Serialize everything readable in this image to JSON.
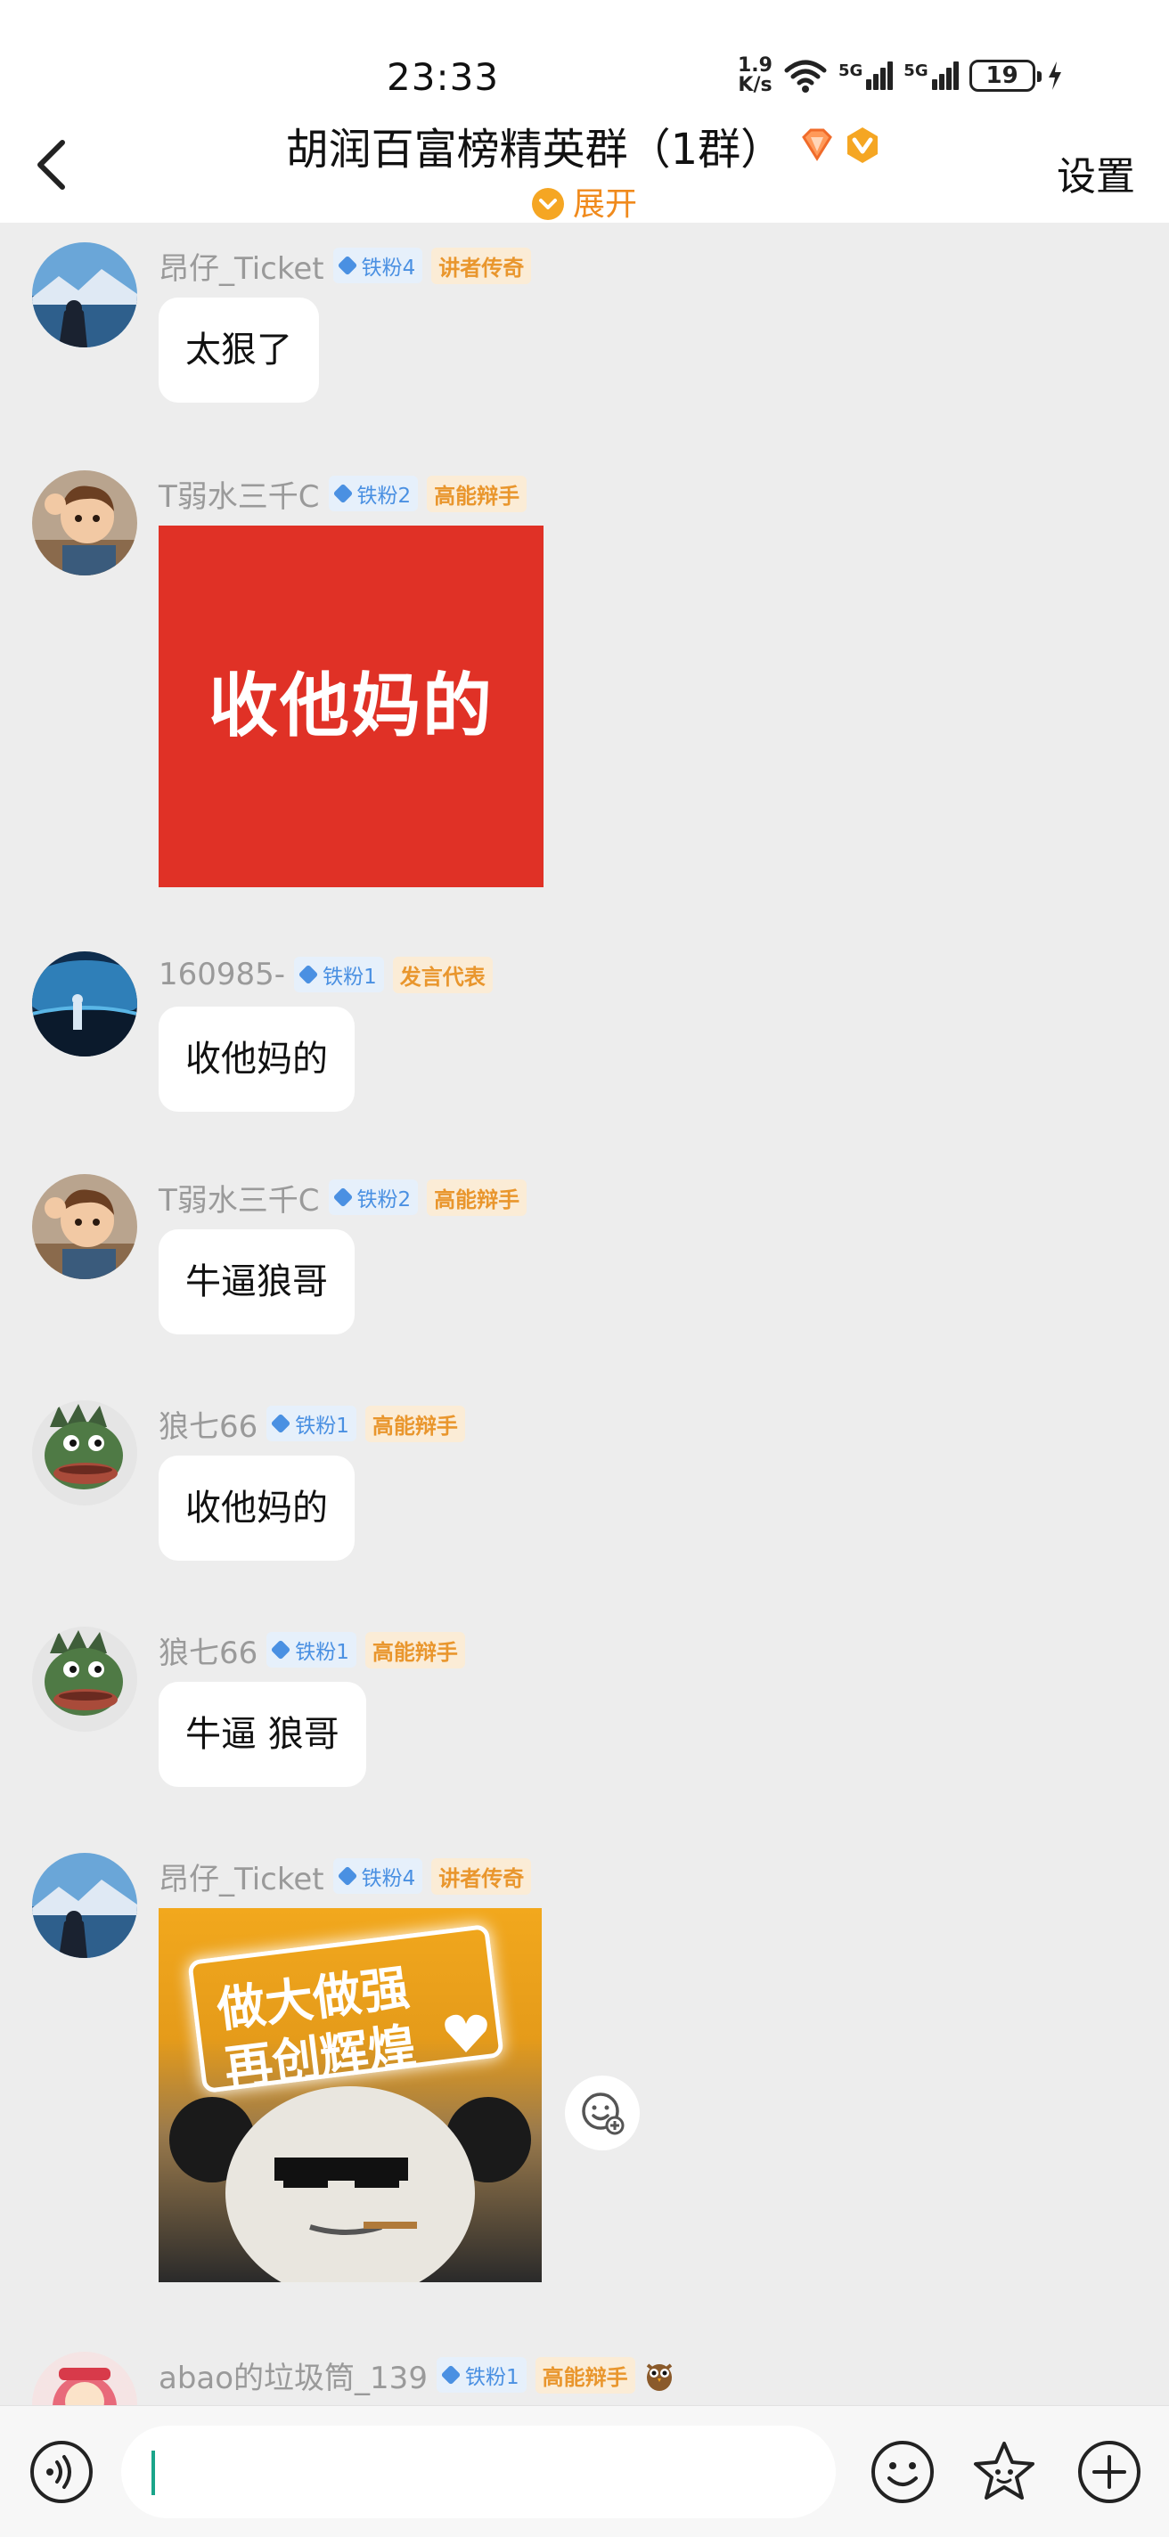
{
  "status_bar": {
    "time": "23:33",
    "net_speed_value": "1.9",
    "net_speed_unit": "K/s",
    "signal1_label": "5G",
    "signal2_label": "5G",
    "battery": "19"
  },
  "header": {
    "title": "胡润百富榜精英群（1群）",
    "expand_label": "展开",
    "settings_label": "设置"
  },
  "messages": [
    {
      "user": "昂仔_Ticket",
      "fan": "铁粉4",
      "tag": "讲者传奇",
      "text": "太狠了"
    },
    {
      "user": "T弱水三千C",
      "fan": "铁粉2",
      "tag": "高能辩手",
      "sticker_text": "收他妈的"
    },
    {
      "user": "160985-",
      "fan": "铁粉1",
      "tag": "发言代表",
      "text": "收他妈的"
    },
    {
      "user": "T弱水三千C",
      "fan": "铁粉2",
      "tag": "高能辩手",
      "text": "牛逼狼哥"
    },
    {
      "user": "狼七66",
      "fan": "铁粉1",
      "tag": "高能辩手",
      "text": "收他妈的"
    },
    {
      "user": "狼七66",
      "fan": "铁粉1",
      "tag": "高能辩手",
      "text": "牛逼 狼哥"
    },
    {
      "user": "昂仔_Ticket",
      "fan": "铁粉4",
      "tag": "讲者传奇",
      "sticker_line1": "做大做强",
      "sticker_line2": "再创辉煌"
    },
    {
      "user": "abao的垃圾筒_139",
      "fan": "铁粉1",
      "tag": "高能辩手"
    }
  ],
  "input": {
    "value": "",
    "placeholder": ""
  },
  "colors": {
    "accent_orange": "#f08a1c",
    "fan_blue": "#4a90e2",
    "tag_bg": "#fbecd6",
    "sticker_red": "#e03126",
    "chat_bg": "#ededed",
    "caret": "#1aa58a"
  },
  "icons": [
    "back-icon",
    "gem-badge-icon",
    "vip-badge-icon",
    "chevron-down-icon",
    "emoji-react-icon",
    "voice-icon",
    "emoji-icon",
    "sticker-icon",
    "plus-icon",
    "owl-icon"
  ]
}
